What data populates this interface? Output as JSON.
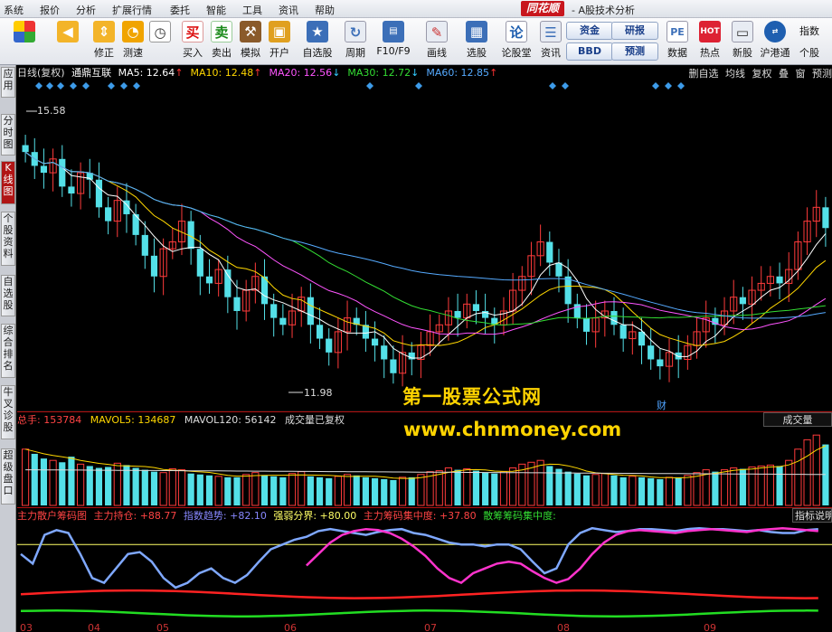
{
  "menubar": {
    "items": [
      "系统",
      "报价",
      "分析",
      "扩展行情",
      "委托",
      "智能",
      "工具",
      "资讯",
      "帮助"
    ],
    "brand": "同花顺",
    "window_title": "- A股技术分析"
  },
  "toolbar": {
    "buttons": [
      {
        "label": "",
        "icon": "color-grid-icon"
      },
      {
        "label": "",
        "icon": "back-arrow-icon"
      },
      {
        "label": "修正",
        "icon": "updown-arrows-icon"
      },
      {
        "label": "测速",
        "icon": "speed-icon"
      },
      {
        "label": "",
        "icon": "clock-icon"
      },
      {
        "label": "买入",
        "icon": "buy-icon",
        "glyph": "买"
      },
      {
        "label": "卖出",
        "icon": "sell-icon",
        "glyph": "卖"
      },
      {
        "label": "模拟",
        "icon": "gavel-icon"
      },
      {
        "label": "开户",
        "icon": "lock-icon"
      },
      {
        "label": "自选股",
        "icon": "star-icon"
      },
      {
        "label": "周期",
        "icon": "cycle-icon"
      },
      {
        "label": "F10/F9",
        "icon": "f10-icon"
      },
      {
        "label": "画线",
        "icon": "pen-icon"
      },
      {
        "label": "选股",
        "icon": "select-stock-icon"
      },
      {
        "label": "论股堂",
        "icon": "forum-icon",
        "glyph": "论"
      },
      {
        "label": "资讯",
        "icon": "news-icon"
      },
      {
        "label": "数据",
        "icon": "pe-icon",
        "glyph": "PE"
      },
      {
        "label": "热点",
        "icon": "hot-icon"
      },
      {
        "label": "新股",
        "icon": "new-stock-icon"
      },
      {
        "label": "沪港通",
        "icon": "sse-hkex-icon"
      }
    ],
    "blue_buttons": [
      "资金",
      "BBD",
      "研报",
      "预测"
    ],
    "right_labels": [
      "指数",
      "个股"
    ]
  },
  "left_tabs": [
    {
      "label": "应用",
      "active": false
    },
    {
      "label": "分时图",
      "active": false
    },
    {
      "label": "K线图",
      "active": true
    },
    {
      "label": "个股资料",
      "active": false
    },
    {
      "label": "自选股",
      "active": false
    },
    {
      "label": "综合排名",
      "active": false
    },
    {
      "label": "牛叉诊股",
      "active": false
    },
    {
      "label": "超级盘口",
      "active": false
    }
  ],
  "info_line": {
    "period": "日线(复权)",
    "stock_name": "通鼎互联",
    "ma": [
      {
        "text": "MA5: 12.64",
        "arrow": "↑",
        "color": "#ffffff"
      },
      {
        "text": "MA10: 12.48",
        "arrow": "↑",
        "color": "#ffd700"
      },
      {
        "text": "MA20: 12.56",
        "arrow": "↓",
        "color": "#ff55ff"
      },
      {
        "text": "MA30: 12.72",
        "arrow": "↓",
        "color": "#33dd33"
      },
      {
        "text": "MA60: 12.85",
        "arrow": "↑",
        "color": "#55aaff"
      }
    ],
    "right_tools": [
      "删自选",
      "均线",
      "复权",
      "叠",
      "窗",
      "预测"
    ]
  },
  "price_annotations": {
    "high": "15.58",
    "low": "11.98"
  },
  "volume_line": {
    "total": "总手: 153784",
    "mavol5": "MAVOL5: 134687",
    "mavol120": "MAVOL120: 56142",
    "note": "成交量已复权",
    "panel_button": "成交量"
  },
  "indicator_line": {
    "name": "主力散户筹码图",
    "items": [
      {
        "text": "主力持仓: +88.77",
        "color": "#ff4444"
      },
      {
        "text": "指数趋势: +82.10",
        "color": "#8888ff"
      },
      {
        "text": "强弱分界: +80.00",
        "color": "#ffff66"
      },
      {
        "text": "主力筹码集中度: +37.80",
        "color": "#ff4444"
      },
      {
        "text": "散筹筹码集中度:",
        "color": "#33dd33"
      }
    ],
    "panel_button": "指标说明"
  },
  "months": [
    "03",
    "04",
    "05",
    "06",
    "07",
    "08",
    "09"
  ],
  "watermark": {
    "line1": "第一股票公式网",
    "line2": "www.chnmoney.com"
  },
  "badge": "财",
  "chart_data": {
    "type": "candlestick",
    "y_range": [
      11.5,
      16.0
    ],
    "close_series": [
      15.2,
      15.0,
      14.9,
      15.1,
      14.7,
      14.6,
      14.9,
      14.8,
      14.4,
      14.2,
      14.5,
      14.3,
      14.0,
      13.7,
      13.4,
      13.8,
      13.9,
      14.2,
      13.8,
      13.4,
      13.3,
      13.5,
      13.1,
      12.9,
      13.2,
      13.4,
      13.0,
      12.8,
      12.7,
      12.9,
      13.1,
      12.7,
      12.5,
      12.3,
      12.6,
      12.8,
      12.7,
      12.5,
      12.4,
      12.2,
      12.0,
      12.3,
      12.2,
      12.4,
      12.6,
      12.7,
      12.9,
      12.8,
      13.0,
      12.9,
      12.8,
      12.7,
      12.9,
      13.2,
      13.4,
      13.7,
      13.9,
      13.6,
      13.4,
      13.0,
      12.8,
      12.6,
      12.8,
      12.9,
      12.7,
      12.5,
      12.6,
      12.4,
      12.2,
      12.1,
      12.3,
      12.2,
      12.4,
      12.6,
      12.8,
      12.7,
      12.9,
      13.1,
      13.0,
      13.2,
      13.3,
      13.4,
      13.3,
      13.5,
      13.9,
      14.2,
      14.4,
      14.1
    ],
    "volume_series": [
      60,
      55,
      50,
      48,
      46,
      52,
      44,
      42,
      40,
      41,
      45,
      43,
      40,
      38,
      36,
      35,
      39,
      38,
      34,
      33,
      32,
      31,
      30,
      30,
      33,
      35,
      32,
      31,
      30,
      34,
      36,
      31,
      30,
      29,
      31,
      33,
      32,
      30,
      29,
      28,
      27,
      30,
      30,
      33,
      36,
      37,
      40,
      38,
      39,
      37,
      35,
      34,
      36,
      40,
      44,
      46,
      48,
      42,
      39,
      36,
      34,
      32,
      33,
      34,
      32,
      30,
      31,
      30,
      29,
      28,
      30,
      30,
      32,
      35,
      38,
      36,
      38,
      40,
      39,
      41,
      42,
      43,
      42,
      48,
      60,
      70,
      75,
      65
    ],
    "indicator_series": {
      "blue": [
        70,
        60,
        90,
        95,
        92,
        70,
        45,
        40,
        55,
        70,
        72,
        62,
        45,
        35,
        40,
        50,
        55,
        45,
        40,
        48,
        62,
        75,
        80,
        85,
        88,
        94,
        96,
        94,
        92,
        90,
        93,
        95,
        96,
        92,
        90,
        86,
        82,
        80,
        80,
        78,
        80,
        80,
        75,
        62,
        50,
        55,
        80,
        92,
        97,
        95,
        93,
        94,
        96,
        96,
        95,
        94,
        96,
        97,
        96,
        96,
        95,
        94,
        95,
        93,
        92,
        92,
        95,
        96
      ],
      "magenta": [
        null,
        null,
        null,
        null,
        null,
        null,
        null,
        null,
        null,
        null,
        null,
        null,
        null,
        null,
        null,
        null,
        null,
        null,
        null,
        null,
        null,
        null,
        null,
        null,
        58,
        70,
        82,
        90,
        94,
        96,
        95,
        92,
        86,
        78,
        68,
        55,
        45,
        40,
        50,
        55,
        60,
        62,
        60,
        52,
        45,
        40,
        44,
        55,
        70,
        82,
        90,
        94,
        95,
        94,
        93,
        92,
        94,
        95,
        96,
        95,
        94,
        93,
        95,
        96,
        97,
        96,
        95,
        94
      ]
    }
  }
}
